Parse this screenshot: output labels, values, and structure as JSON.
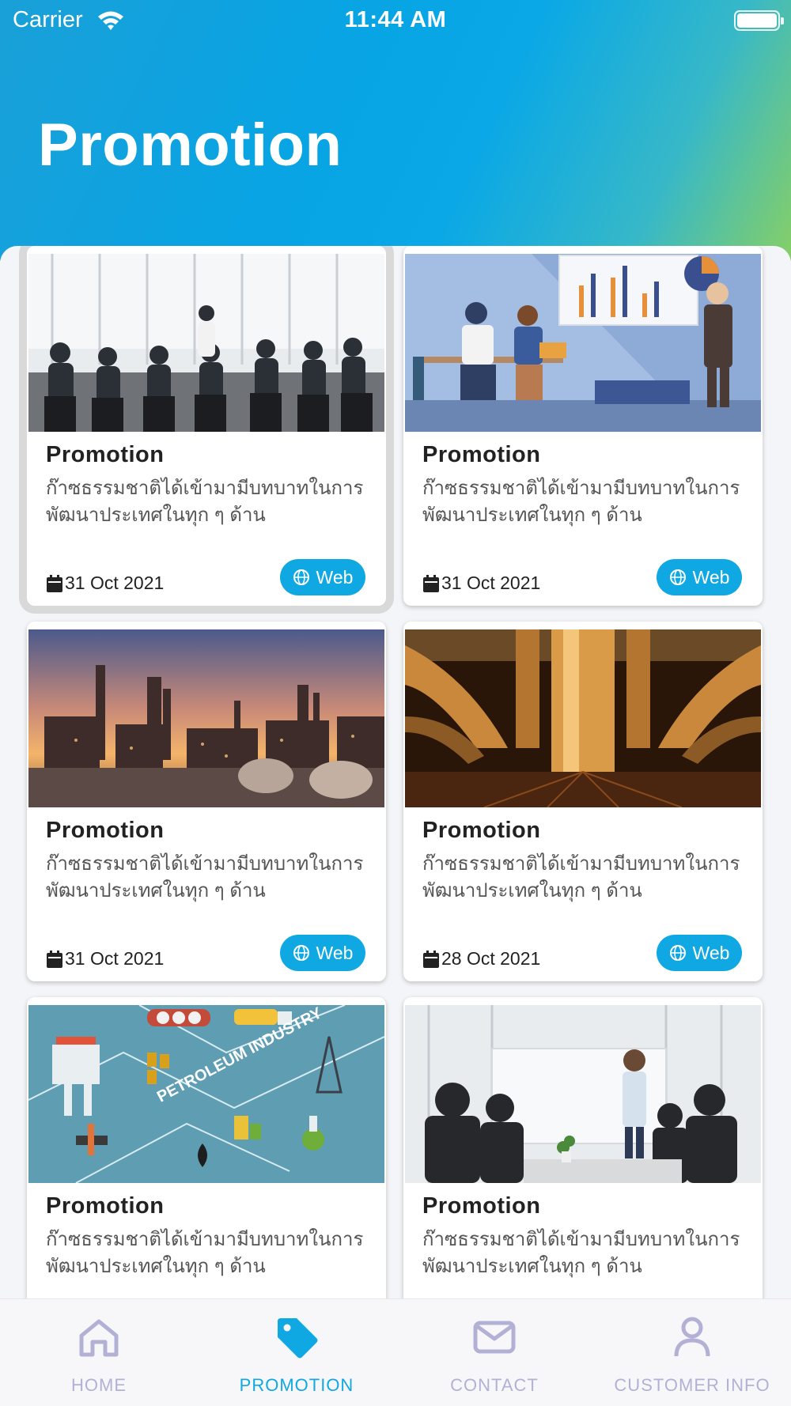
{
  "status_bar": {
    "carrier": "Carrier",
    "time": "11:44 AM"
  },
  "header": {
    "title": "Promotion"
  },
  "colors": {
    "accent": "#10a8e2",
    "tab_inactive": "#b3b0d6"
  },
  "cards": [
    {
      "title": "Promotion",
      "description": "ก๊าซธรรมชาติได้เข้ามามีบทบาทในการพัฒนาประเทศในทุก ๆ ด้าน",
      "date": "31 Oct 2021",
      "button": "Web",
      "image": "business-meeting-photo"
    },
    {
      "title": "Promotion",
      "description": "ก๊าซธรรมชาติได้เข้ามามีบทบาทในการพัฒนาประเทศในทุก ๆ ด้าน",
      "date": "31 Oct 2021",
      "button": "Web",
      "image": "office-presentation-illustration"
    },
    {
      "title": "Promotion",
      "description": "ก๊าซธรรมชาติได้เข้ามามีบทบาทในการพัฒนาประเทศในทุก ๆ ด้าน",
      "date": "31 Oct 2021",
      "button": "Web",
      "image": "refinery-sunset-photo"
    },
    {
      "title": "Promotion",
      "description": "ก๊าซธรรมชาติได้เข้ามามีบทบาทในการพัฒนาประเทศในทุก ๆ ด้าน",
      "date": "28 Oct 2021",
      "button": "Web",
      "image": "industrial-pipes-photo"
    },
    {
      "title": "Promotion",
      "description": "ก๊าซธรรมชาติได้เข้ามามีบทบาทในการพัฒนาประเทศในทุก ๆ ด้าน",
      "date": "",
      "button": "",
      "image": "petroleum-industry-illustration",
      "image_text": "PETROLEUM INDUSTRY"
    },
    {
      "title": "Promotion",
      "description": "ก๊าซธรรมชาติได้เข้ามามีบทบาทในการพัฒนาประเทศในทุก ๆ ด้าน",
      "date": "",
      "button": "",
      "image": "whiteboard-meeting-photo"
    }
  ],
  "tabbar": {
    "items": [
      {
        "label": "HOME",
        "icon": "home-icon",
        "active": false
      },
      {
        "label": "PROMOTION",
        "icon": "tag-icon",
        "active": true
      },
      {
        "label": "CONTACT",
        "icon": "mail-icon",
        "active": false
      },
      {
        "label": "CUSTOMER INFO",
        "icon": "person-icon",
        "active": false
      }
    ]
  }
}
